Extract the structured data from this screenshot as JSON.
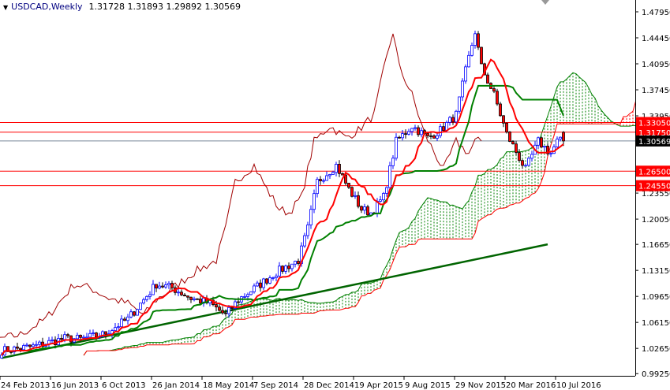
{
  "header": {
    "symbol_period": "USDCAD,Weekly",
    "ohlc": "1.31728 1.31893 1.29892 1.30569"
  },
  "chart_data": {
    "type": "candlestick",
    "title": "USDCAD,Weekly",
    "indicator": "Ichimoku Kinko Hyo",
    "ylim": [
      0.9925,
      1.4795
    ],
    "y_ticks": [
      "1.47950",
      "1.44450",
      "1.40950",
      "1.37450",
      "1.33950",
      "1.23550",
      "1.20050",
      "1.16650",
      "1.13150",
      "1.09650",
      "1.06150",
      "1.02650",
      "0.99250"
    ],
    "y_tick_values": [
      1.4795,
      1.4445,
      1.4095,
      1.3745,
      1.3395,
      1.2355,
      1.2005,
      1.1665,
      1.1315,
      1.0965,
      1.0615,
      1.0265,
      0.9925
    ],
    "x_ticks": [
      "24 Feb 2013",
      "16 Jun 2013",
      "6 Oct 2013",
      "26 Jan 2014",
      "18 May 2014",
      "7 Sep 2014",
      "28 Dec 2014",
      "19 Apr 2015",
      "9 Aug 2015",
      "29 Nov 2015",
      "20 Mar 2016",
      "10 Jul 2016"
    ],
    "x_tick_week_index": [
      0,
      16,
      32,
      48,
      64,
      80,
      96,
      112,
      128,
      144,
      160,
      176
    ],
    "close_anchors_week_price": [
      [
        0,
        1.0235
      ],
      [
        10,
        1.029
      ],
      [
        20,
        1.04
      ],
      [
        25,
        1.039
      ],
      [
        32,
        1.045
      ],
      [
        40,
        1.066
      ],
      [
        45,
        1.092
      ],
      [
        49,
        1.113
      ],
      [
        54,
        1.108
      ],
      [
        60,
        1.094
      ],
      [
        66,
        1.087
      ],
      [
        71,
        1.071
      ],
      [
        75,
        1.092
      ],
      [
        82,
        1.113
      ],
      [
        87,
        1.129
      ],
      [
        94,
        1.145
      ],
      [
        97,
        1.188
      ],
      [
        100,
        1.251
      ],
      [
        106,
        1.273
      ],
      [
        110,
        1.241
      ],
      [
        114,
        1.214
      ],
      [
        117,
        1.209
      ],
      [
        121,
        1.23
      ],
      [
        125,
        1.305
      ],
      [
        130,
        1.326
      ],
      [
        135,
        1.31
      ],
      [
        139,
        1.32
      ],
      [
        144,
        1.341
      ],
      [
        147,
        1.4
      ],
      [
        150,
        1.453
      ],
      [
        152,
        1.405
      ],
      [
        156,
        1.368
      ],
      [
        160,
        1.315
      ],
      [
        164,
        1.283
      ],
      [
        166,
        1.267
      ],
      [
        170,
        1.305
      ],
      [
        174,
        1.289
      ],
      [
        176,
        1.305
      ],
      [
        178,
        1.30569
      ]
    ],
    "last_bar": {
      "open": 1.31728,
      "high": 1.31893,
      "low": 1.29892,
      "close": 1.30569
    },
    "levels": [
      {
        "label": "1.33050",
        "value": 1.3305,
        "color": "#ff0000"
      },
      {
        "label": "1.31750",
        "value": 1.3175,
        "color": "#ff0000"
      },
      {
        "label": "1.30569",
        "value": 1.30569,
        "color": "#000000",
        "line": "#778899"
      },
      {
        "label": "1.26500",
        "value": 1.265,
        "color": "#ff0000"
      },
      {
        "label": "1.24550",
        "value": 1.2455,
        "color": "#ff0000"
      }
    ],
    "trendline": {
      "from": [
        0,
        1.0135
      ],
      "to": [
        173,
        1.1665
      ],
      "color": "#006400"
    },
    "colors": {
      "up_body": "#ffffff",
      "up_line": "#0000ff",
      "down_body": "#ff0000",
      "down_line": "#000000",
      "tenkan": "#ff0000",
      "kijun": "#008000",
      "chikou": "#a00000",
      "cloud_up": "#008000",
      "cloud_down": "#ff0000"
    }
  }
}
